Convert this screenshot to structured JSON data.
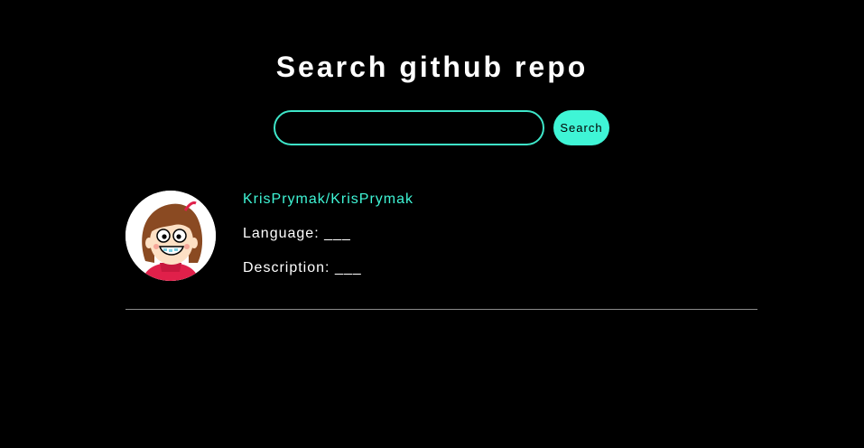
{
  "header": {
    "title": "Search github repo"
  },
  "search": {
    "value": "",
    "placeholder": "",
    "button_label": "Search"
  },
  "results": [
    {
      "full_name": "KrisPrymak/KrisPrymak",
      "language_label": "Language:",
      "language_value": "___",
      "description_label": "Description:",
      "description_value": "___",
      "avatar_icon": "cartoon-girl-avatar"
    }
  ],
  "colors": {
    "background": "#000000",
    "accent": "#3ff5d6",
    "text": "#ffffff",
    "divider": "#8a8a8a"
  }
}
